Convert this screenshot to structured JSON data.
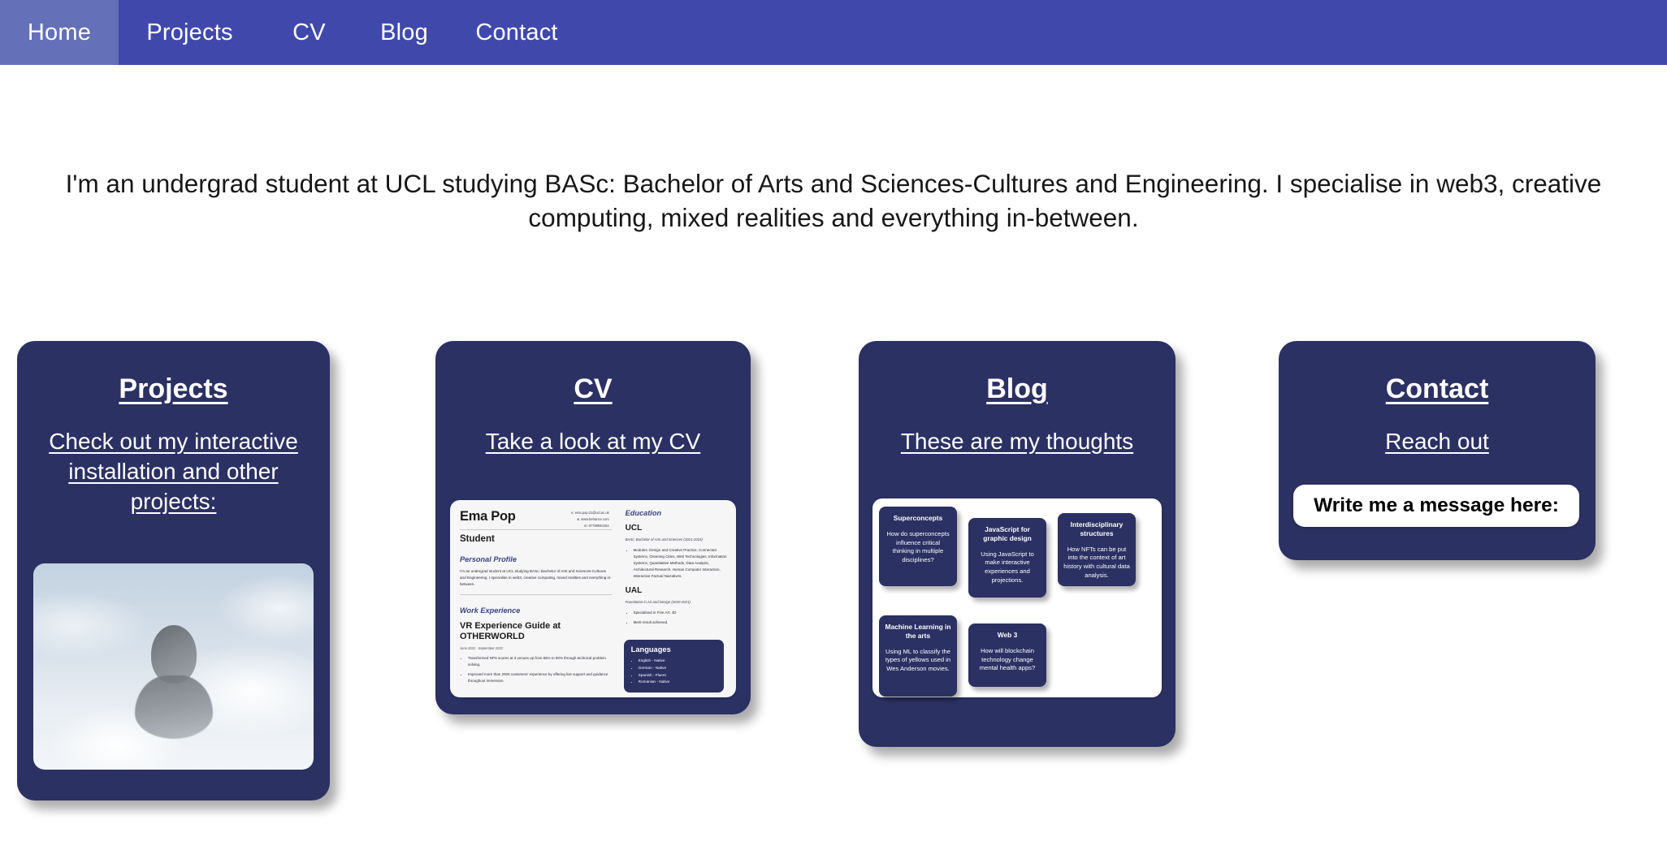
{
  "nav": {
    "items": [
      {
        "label": "Home",
        "active": true
      },
      {
        "label": "Projects",
        "active": false
      },
      {
        "label": "CV",
        "active": false
      },
      {
        "label": "Blog",
        "active": false
      },
      {
        "label": "Contact",
        "active": false
      }
    ],
    "bar_color": "#4049ab",
    "active_color": "#6470b8"
  },
  "intro": {
    "text": "I'm an undergrad student at UCL studying BASc: Bachelor of Arts and Sciences-Cultures and Engineering. I specialise in web3, creative computing, mixed realities and everything in-between."
  },
  "cards": {
    "card_color": "#2b3163",
    "projects": {
      "title": "Projects",
      "subtitle": "Check out my interactive installation and other projects:",
      "image_alt": "greyscale-figure-in-clouds"
    },
    "cv": {
      "title": "CV",
      "subtitle": "Take a look at my CV"
    },
    "blog": {
      "title": "Blog",
      "subtitle": "These are my thoughts"
    },
    "contact": {
      "title": "Contact",
      "subtitle": "Reach out",
      "message_label": "Write me a message here:"
    }
  },
  "cv_document": {
    "name": "Ema Pop",
    "role": "Student",
    "contact": {
      "email": "e: ema.pop.21@ucl.ac.uk",
      "web": "w: www.behance.com",
      "mobile": "m: 07780940151"
    },
    "personal_profile": {
      "heading": "Personal Profile",
      "body": "I'm an undergrad student at UCL studying BASc: Bachelor of Arts and Sciences-Cultures and Engineering. I specialise in web3, creative computing, mixed realities and everything in-between."
    },
    "work_experience": {
      "heading": "Work Experience",
      "job_title": "VR Experience Guide at OTHERWORLD",
      "dates": "June 2022 - September 2022",
      "bullets": [
        "Transformed NPS scores at 3 venues up from 65% to 90% through technical problem solving.",
        "Improved more than 2000 customers' experience by offering live support and guidance throughout immersion."
      ]
    },
    "education": {
      "heading": "Education",
      "entries": [
        {
          "institution": "UCL",
          "detail": "BASc: Bachelor of Arts and Sciences (2021-2024)",
          "bullets": [
            "Modules: Design and Creative Practice, Connected Systems, Greening Cities, Web Technologies, Information Systems, Quantitative Methods, Data Analysis, Architectural Research, Human Computer Interaction, Interactive Factual Narratives."
          ]
        },
        {
          "institution": "UAL",
          "detail": "Foundation in Art and Design (2020-2021)",
          "bullets": [
            "Specialised in Fine Art: 4D",
            "Merit result achieved."
          ]
        }
      ]
    },
    "languages": {
      "heading": "Languages",
      "items": [
        "English - Native",
        "German - Native",
        "Spanish - Fluent",
        "Romanian - Native"
      ]
    }
  },
  "blog_tiles": [
    {
      "title": "Superconcepts",
      "desc": "How do superconcepts influence critical thinking in multiple disciplines?"
    },
    {
      "title": "JavaScript for graphic design",
      "desc": "Using JavaScript to make interactive experiences and projections."
    },
    {
      "title": "Interdisciplinary structures",
      "desc": "How NFTs can be put into the context of art history with cultural data analysis."
    },
    {
      "title": "Machine Learning in the arts",
      "desc": "Using ML to classify the types of yellows used in Wes Anderson movies."
    },
    {
      "title": "Web 3",
      "desc": "How will blockchain technology change mental health apps?"
    }
  ]
}
